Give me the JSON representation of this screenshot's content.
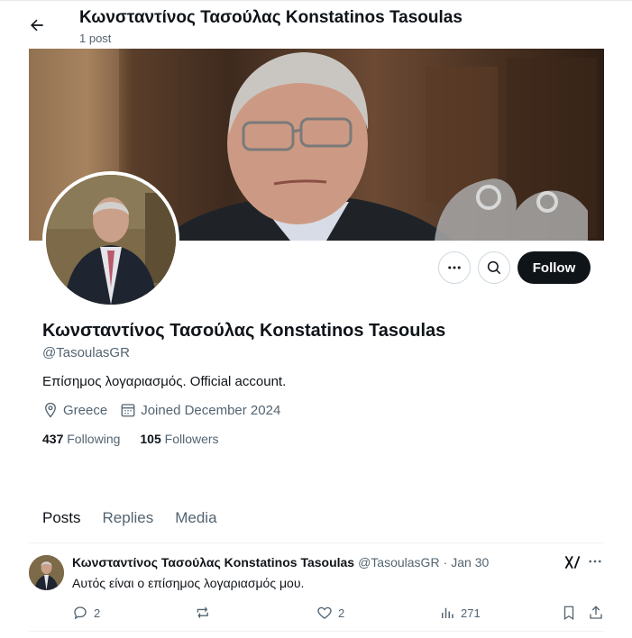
{
  "header": {
    "title": "Κωνσταντίνος Τασούλας Konstatinos Tasoulas",
    "post_count": "1 post",
    "back_icon": "arrow-left-icon"
  },
  "banner": {
    "description_icon": "banner-photo"
  },
  "profile": {
    "display_name": "Κωνσταντίνος Τασούλας Konstatinos Tasoulas",
    "handle": "@TasoulasGR",
    "bio": "Επίσημος λογαριασμός. Official account.",
    "location": "Greece",
    "joined": "Joined December 2024",
    "following_count": "437",
    "following_label": "Following",
    "followers_count": "105",
    "followers_label": "Followers"
  },
  "buttons": {
    "follow_label": "Follow",
    "more_icon": "more-dots-icon",
    "search_icon": "search-icon"
  },
  "tabs": [
    {
      "label": "Posts",
      "active": true
    },
    {
      "label": "Replies",
      "active": false
    },
    {
      "label": "Media",
      "active": false
    }
  ],
  "tweet": {
    "name": "Κωνσταντίνος Τασούλας Konstatinos Tasoulas",
    "handle": "@TasoulasGR",
    "separator": "·",
    "date": "Jan 30",
    "text": "Αυτός είναι ο επίσημος λογαριασμός μου.",
    "replies": "2",
    "reposts": "",
    "likes": "2",
    "views": "271"
  },
  "colors": {
    "text_primary": "#0f1419",
    "text_secondary": "#536471",
    "follow_bg": "#0f1419",
    "border": "#cfd9de"
  }
}
